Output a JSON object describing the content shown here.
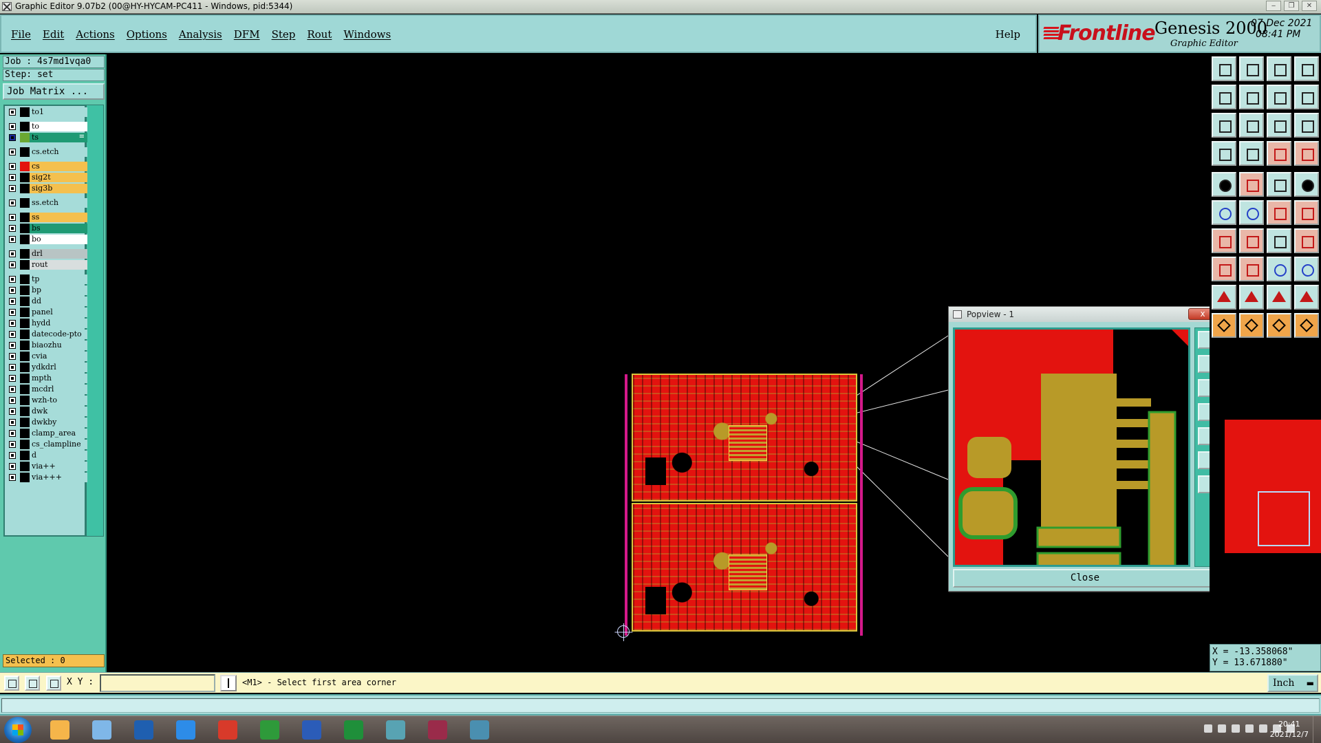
{
  "window": {
    "title": "Graphic Editor 9.07b2 (00@HY-HYCAM-PC411 - Windows, pid:5344)",
    "controls": [
      "minimize",
      "restore",
      "close"
    ]
  },
  "menubar": {
    "items": [
      "File",
      "Edit",
      "Actions",
      "Options",
      "Analysis",
      "DFM",
      "Step",
      "Rout",
      "Windows"
    ],
    "help": "Help"
  },
  "brand": {
    "logo": "Frontline",
    "product": "Genesis 2000",
    "subtitle": "Graphic Editor",
    "date": "07 Dec 2021",
    "time": "08:41 PM",
    "logo_color": "#c8101c"
  },
  "job": {
    "job_label": "Job : 4s7md1vqa0",
    "step_label": "Step: set",
    "matrix_button": "Job Matrix ..."
  },
  "layers": [
    {
      "name": "to1",
      "color": "#a6dcd9",
      "swatch": "#000000",
      "checked": false
    },
    {
      "name": "to",
      "color": "#ffffff",
      "swatch": "#000000",
      "checked": false
    },
    {
      "name": "ts",
      "color": "#1f9a74",
      "swatch": "#6aa832",
      "checked": true,
      "marker": "≡"
    },
    {
      "name": "cs.etch",
      "color": "#a6dcd9",
      "swatch": "#000000",
      "checked": false
    },
    {
      "name": "cs",
      "color": "#f4c04e",
      "swatch": "#e3130f",
      "checked": false
    },
    {
      "name": "sig2t",
      "color": "#f4c04e",
      "swatch": "#000000",
      "checked": false
    },
    {
      "name": "sig3b",
      "color": "#f4c04e",
      "swatch": "#000000",
      "checked": false
    },
    {
      "name": "ss.etch",
      "color": "#a6dcd9",
      "swatch": "#000000",
      "checked": false
    },
    {
      "name": "ss",
      "color": "#f4c04e",
      "swatch": "#000000",
      "checked": false
    },
    {
      "name": "bs",
      "color": "#1f9a74",
      "swatch": "#000000",
      "checked": false
    },
    {
      "name": "bo",
      "color": "#ffffff",
      "swatch": "#000000",
      "checked": false
    },
    {
      "name": "drl",
      "color": "#b8c4c4",
      "swatch": "#000000",
      "checked": false
    },
    {
      "name": "rout",
      "color": "#d8dede",
      "swatch": "#000000",
      "checked": false
    },
    {
      "name": "tp",
      "color": "#a6dcd9",
      "swatch": "#000000",
      "checked": false
    },
    {
      "name": "bp",
      "color": "#a6dcd9",
      "swatch": "#000000",
      "checked": false
    },
    {
      "name": "dd",
      "color": "#a6dcd9",
      "swatch": "#000000",
      "checked": false
    },
    {
      "name": "panel",
      "color": "#a6dcd9",
      "swatch": "#000000",
      "checked": false
    },
    {
      "name": "hydd",
      "color": "#a6dcd9",
      "swatch": "#000000",
      "checked": false
    },
    {
      "name": "datecode-pto",
      "color": "#a6dcd9",
      "swatch": "#000000",
      "checked": false
    },
    {
      "name": "biaozhu",
      "color": "#a6dcd9",
      "swatch": "#000000",
      "checked": false
    },
    {
      "name": "cvia",
      "color": "#a6dcd9",
      "swatch": "#000000",
      "checked": false
    },
    {
      "name": "ydkdrl",
      "color": "#a6dcd9",
      "swatch": "#000000",
      "checked": false
    },
    {
      "name": "mpth",
      "color": "#a6dcd9",
      "swatch": "#000000",
      "checked": false
    },
    {
      "name": "mcdrl",
      "color": "#a6dcd9",
      "swatch": "#000000",
      "checked": false
    },
    {
      "name": "wzh-to",
      "color": "#a6dcd9",
      "swatch": "#000000",
      "checked": false
    },
    {
      "name": "dwk",
      "color": "#a6dcd9",
      "swatch": "#000000",
      "checked": false
    },
    {
      "name": "dwkby",
      "color": "#a6dcd9",
      "swatch": "#000000",
      "checked": false
    },
    {
      "name": "clamp_area",
      "color": "#a6dcd9",
      "swatch": "#000000",
      "checked": false
    },
    {
      "name": "cs_clampline",
      "color": "#a6dcd9",
      "swatch": "#000000",
      "checked": false
    },
    {
      "name": "d",
      "color": "#a6dcd9",
      "swatch": "#000000",
      "checked": false
    },
    {
      "name": "via++",
      "color": "#a6dcd9",
      "swatch": "#000000",
      "checked": false
    },
    {
      "name": "via+++",
      "color": "#a6dcd9",
      "swatch": "#000000",
      "checked": false
    }
  ],
  "selection": {
    "label": "Selected : 0"
  },
  "popview": {
    "title": "Popview - 1",
    "close_x": "x",
    "close_button": "Close"
  },
  "coords": {
    "x": "X = -13.358068\"",
    "y": "Y = 13.671880\""
  },
  "statusbar": {
    "xy_label": "X Y :",
    "xy_value": "",
    "prompt": "<M1> - Select first area corner",
    "units": "Inch"
  },
  "colors": {
    "copper": "#e3130f",
    "pad": "#b89a28",
    "panel_teal": "#a4d8d3",
    "layer_highlight": "#f4c04e"
  },
  "taskbar": {
    "apps": [
      "start-orb",
      "genesis",
      "notepad",
      "save",
      "feishu",
      "foxit",
      "ptc",
      "word",
      "excel",
      "genesis-view",
      "xmind",
      "genesis-cam"
    ],
    "clock_time": "20:41",
    "clock_date": "2021/12/7"
  }
}
